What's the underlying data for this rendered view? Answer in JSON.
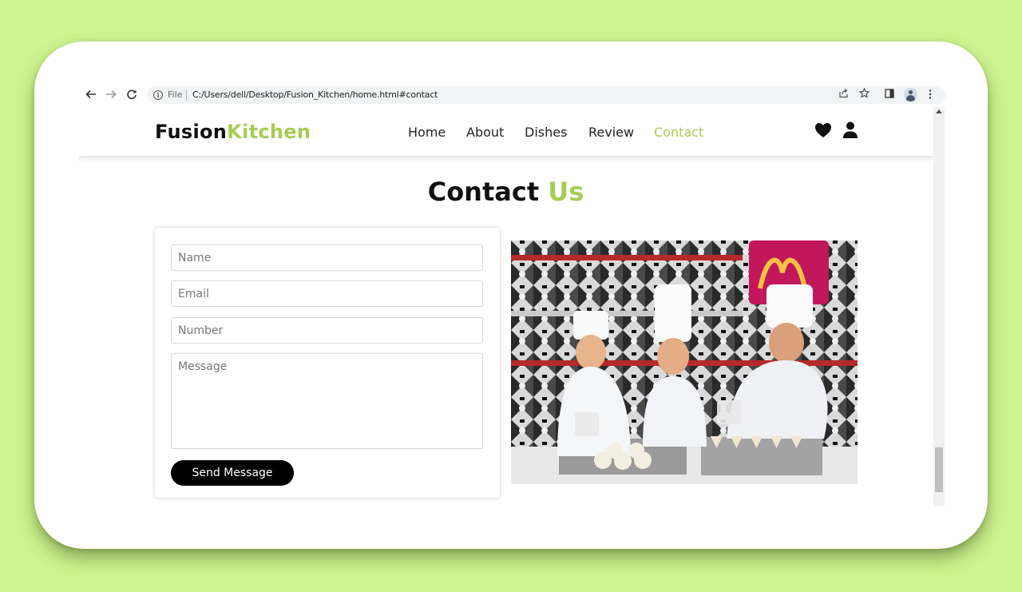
{
  "browser": {
    "file_label": "File",
    "url": "C:/Users/dell/Desktop/Fusion_Kitchen/home.html#contact"
  },
  "site": {
    "logo_part1": "Fusion",
    "logo_part2": "Kitchen",
    "nav": [
      "Home",
      "About",
      "Dishes",
      "Review",
      "Contact"
    ],
    "active_nav": "Contact"
  },
  "contact": {
    "title_part1": "Contact",
    "title_part2": "Us",
    "placeholders": {
      "name": "Name",
      "email": "Email",
      "number": "Number",
      "message": "Message"
    },
    "button": "Send Message"
  },
  "colors": {
    "accent": "#a6cd54",
    "background": "#cdf490",
    "button": "#000000"
  },
  "icons": [
    "back-arrow-icon",
    "forward-arrow-icon",
    "reload-icon",
    "info-icon",
    "share-icon",
    "star-icon",
    "side-panel-icon",
    "profile-icon",
    "menu-dots-icon",
    "heart-icon",
    "user-icon"
  ]
}
